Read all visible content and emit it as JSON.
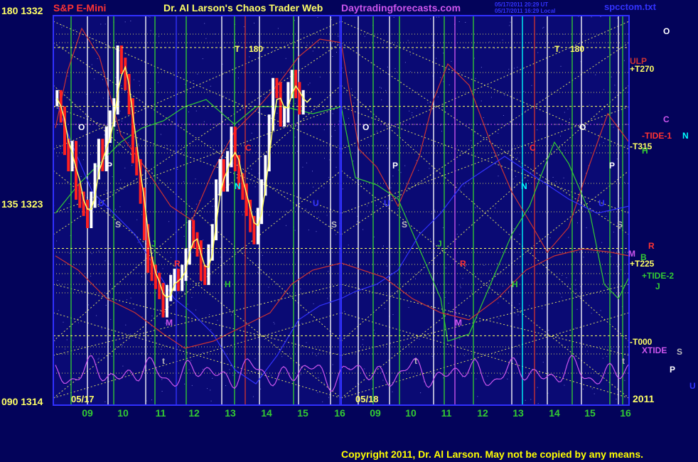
{
  "header": {
    "instrument": "S&P E-Mini",
    "title": "Dr. Al Larson's Chaos Trader Web",
    "site": "Daytradingforecasts.com",
    "timestamp_ut": "05/17/2011 20:29 UT",
    "timestamp_local": "05/17/2011 16:29 Local",
    "file": "spcctom.txt"
  },
  "copyright": "Copyright 2011, Dr. Al Larson. May not be copied by any means.",
  "colors": {
    "background": "#03035a",
    "plot_background": "#0a0a74",
    "frame": "#3030ff",
    "green_grid": "#33cc33",
    "yellow_grid": "#ffff66",
    "price_up": "#ffffff",
    "price_down": "#ff2020",
    "tide_line": "#cc3333",
    "green_curve": "#33cc33",
    "xtide": "#cc55ee"
  },
  "chart_data": {
    "type": "line",
    "title": "Dr. Al Larson's Chaos Trader Web",
    "instrument": "S&P E-Mini",
    "y_labels": [
      {
        "angle": "180",
        "price": "1332"
      },
      {
        "angle": "135",
        "price": "1323"
      },
      {
        "angle": "090",
        "price": "1314"
      }
    ],
    "ylim": [
      1314,
      1332
    ],
    "date_labels": [
      "05/17",
      "05/18"
    ],
    "year_label": "2011",
    "hour_ticks_day1": [
      "09",
      "10",
      "11",
      "12",
      "13",
      "14",
      "15",
      "16"
    ],
    "hour_ticks_day2": [
      "09",
      "10",
      "11",
      "12",
      "13",
      "14",
      "15",
      "16"
    ],
    "xlim": [
      8.4,
      16.0
    ],
    "price_series": {
      "name": "S&P E-Mini",
      "hours": [
        8.5,
        8.6,
        8.7,
        8.8,
        8.9,
        9.0,
        9.1,
        9.2,
        9.3,
        9.4,
        9.5,
        9.6,
        9.7,
        9.8,
        9.9,
        10.0,
        10.1,
        10.2,
        10.3,
        10.4,
        10.5,
        10.6,
        10.7,
        10.8,
        10.9,
        11.0,
        11.1,
        11.2,
        11.3,
        11.4,
        11.5,
        11.6,
        11.7,
        11.8,
        11.9,
        12.0,
        12.1,
        12.2,
        12.3,
        12.4,
        12.5,
        12.6,
        12.7,
        12.8,
        12.9,
        13.0,
        13.1,
        13.2,
        13.3,
        13.4,
        13.5,
        13.6,
        13.7,
        13.8,
        13.9,
        14.0,
        14.1,
        14.2,
        14.3,
        14.4,
        14.5,
        14.6,
        14.7,
        14.8,
        14.9,
        15.0,
        15.1,
        15.2,
        15.3,
        15.4,
        15.5,
        15.6,
        15.7,
        15.8,
        15.9,
        16.0
      ],
      "close": [
        1328.0,
        1327.2,
        1325.6,
        1324.8,
        1325.5,
        1323.4,
        1323.0,
        1322.6,
        1322.0,
        1323.0,
        1324.4,
        1325.6,
        1324.8,
        1326.2,
        1327.0,
        1327.6,
        1330.2,
        1329.6,
        1328.8,
        1327.6,
        1325.2,
        1324.6,
        1323.2,
        1321.4,
        1319.8,
        1319.4,
        1319.0,
        1318.5,
        1317.6,
        1318.4,
        1318.9,
        1319.2,
        1318.9,
        1319.4,
        1320.2,
        1321.6,
        1321.0,
        1320.6,
        1319.4,
        1319.2,
        1320.4,
        1321.4,
        1323.6,
        1324.6,
        1323.8,
        1325.0,
        1326.2,
        1324.8,
        1323.9,
        1323.4,
        1322.6,
        1321.8,
        1321.2,
        1322.2,
        1323.6,
        1324.8,
        1326.8,
        1328.6,
        1328.4,
        1327.0,
        1327.2,
        1328.4,
        1329.0,
        1328.4,
        1327.6,
        1328.0
      ]
    },
    "hlines": [
      {
        "label": "+T270",
        "price": 1330.5,
        "color": "#ffff66"
      },
      {
        "label": "-T315",
        "price": 1327.6,
        "color": "#ffff66"
      },
      {
        "label": "+T225",
        "price": 1320.6,
        "color": "#ffff66"
      },
      {
        "label": "-T000",
        "price": 1316.3,
        "color": "#ffff66"
      }
    ],
    "right_labels": [
      {
        "text": "O",
        "color": "#ffffff"
      },
      {
        "text": "ULP",
        "color": "#cc3333"
      },
      {
        "text": "+T270",
        "color": "#ffff66"
      },
      {
        "text": "C",
        "color": "#cc55ee"
      },
      {
        "text": "-TIDE-1",
        "color": "#ff3333"
      },
      {
        "text": "N",
        "color": "#00ffff"
      },
      {
        "text": "-T315",
        "color": "#ffff66"
      },
      {
        "text": "H",
        "color": "#33cc33"
      },
      {
        "text": "R",
        "color": "#ff3333"
      },
      {
        "text": "M",
        "color": "#cc55ee"
      },
      {
        "text": "B",
        "color": "#33cc33"
      },
      {
        "text": "+T225",
        "color": "#ffff66"
      },
      {
        "text": "+TIDE-2",
        "color": "#33cc33"
      },
      {
        "text": "J",
        "color": "#33cc33"
      },
      {
        "text": "-T000",
        "color": "#ffff66"
      },
      {
        "text": "XTIDE",
        "color": "#cc55ee"
      },
      {
        "text": "S",
        "color": "#bbbbbb"
      },
      {
        "text": "P",
        "color": "#ffffff"
      },
      {
        "text": "U",
        "color": "#3333ff"
      }
    ],
    "plot_letters": [
      {
        "text": "T",
        "color": "#ffff66"
      },
      {
        "text": "180",
        "color": "#ffff66"
      },
      {
        "text": "O",
        "color": "#ffffff"
      },
      {
        "text": "P",
        "color": "#ffffff"
      },
      {
        "text": "C",
        "color": "#ff3333"
      },
      {
        "text": "N",
        "color": "#00ffff"
      },
      {
        "text": "U",
        "color": "#3333ff"
      },
      {
        "text": "S",
        "color": "#bbbbbb"
      },
      {
        "text": "J",
        "color": "#33cc33"
      },
      {
        "text": "R",
        "color": "#ff3333"
      },
      {
        "text": "H",
        "color": "#33cc33"
      },
      {
        "text": "M",
        "color": "#cc55ee"
      },
      {
        "text": "t",
        "color": "#bbbbbb"
      }
    ]
  }
}
